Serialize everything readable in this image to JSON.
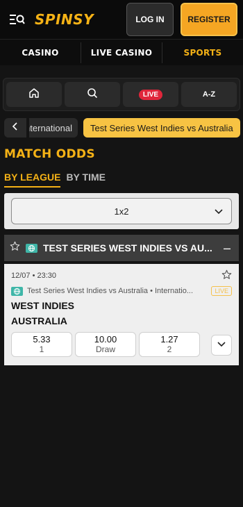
{
  "header": {
    "logo": "SPINSY",
    "login_label": "LOG IN",
    "register_label": "REGISTER",
    "accent_color": "#f5b216"
  },
  "main_nav": {
    "items": [
      "CASINO",
      "LIVE CASINO",
      "SPORTS"
    ],
    "active": "SPORTS"
  },
  "quickbar": {
    "items": [
      {
        "icon": "home-icon"
      },
      {
        "icon": "search-icon"
      },
      {
        "label": "LIVE"
      },
      {
        "label": "A-Z"
      }
    ]
  },
  "breadcrumb": {
    "previous": "International",
    "current": "Test Series West Indies vs Australia"
  },
  "page_title": "MATCH ODDS",
  "tabs": {
    "by_league": "BY LEAGUE",
    "by_time": "BY TIME",
    "active": "BY LEAGUE"
  },
  "market_select": {
    "value": "1x2"
  },
  "league": {
    "name": "TEST SERIES WEST INDIES VS AU...",
    "collapse_symbol": "–"
  },
  "event": {
    "datetime": "12/07 • 23:30",
    "league_path": "Test Series West Indies vs Australia • Internatio...",
    "live_badge": "LIVE",
    "home_team": "WEST INDIES",
    "away_team": "AUSTRALIA",
    "odds": [
      {
        "value": "5.33",
        "label": "1"
      },
      {
        "value": "10.00",
        "label": "Draw"
      },
      {
        "value": "1.27",
        "label": "2"
      }
    ]
  }
}
